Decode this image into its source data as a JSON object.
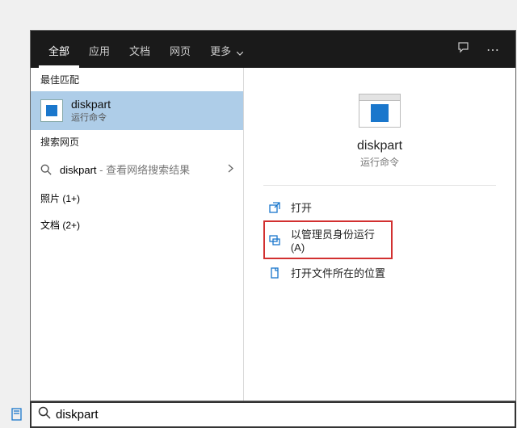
{
  "tabs": {
    "all": "全部",
    "apps": "应用",
    "docs": "文档",
    "web": "网页",
    "more": "更多"
  },
  "sections": {
    "best_match": "最佳匹配",
    "search_web": "搜索网页",
    "photos": "照片 (1+)",
    "docs": "文档 (2+)"
  },
  "best_match": {
    "title": "diskpart",
    "subtitle": "运行命令"
  },
  "web_item": {
    "term": "diskpart",
    "suffix": " - 查看网络搜索结果"
  },
  "preview": {
    "title": "diskpart",
    "subtitle": "运行命令"
  },
  "actions": {
    "open": "打开",
    "run_admin": "以管理员身份运行(A)",
    "open_location": "打开文件所在的位置"
  },
  "search": {
    "value": "diskpart"
  }
}
